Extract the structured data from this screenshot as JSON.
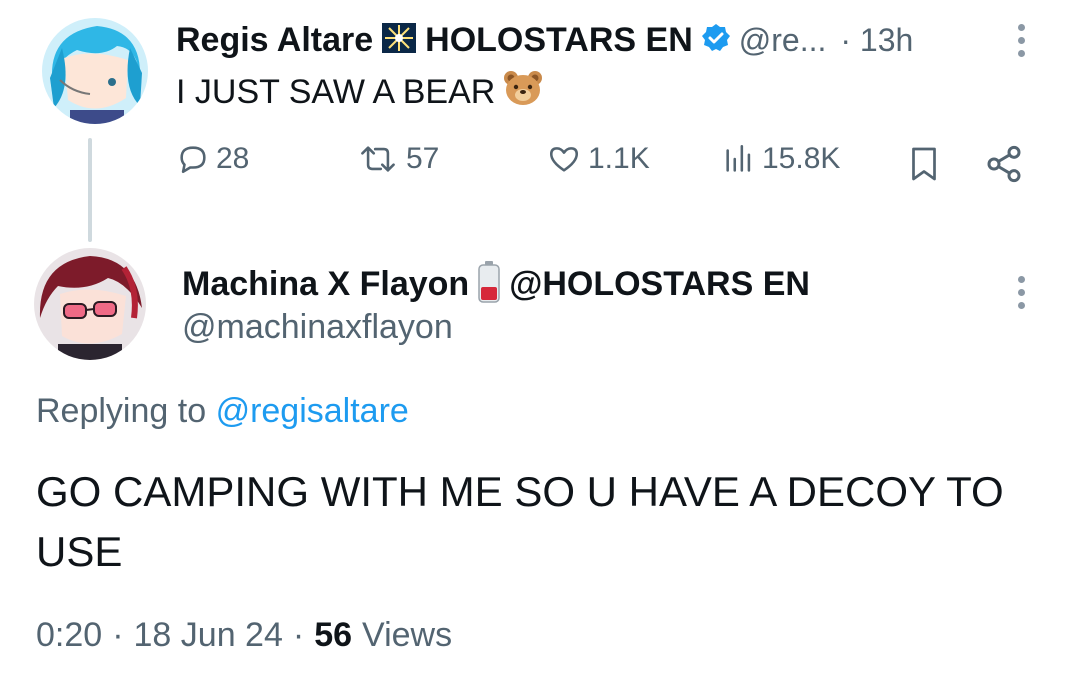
{
  "parent_tweet": {
    "display_name": "Regis Altare",
    "org_label": "HOLOSTARS EN",
    "handle": "@re...",
    "time": "· 13h",
    "text": "I JUST SAW A BEAR",
    "emoji": "🐻",
    "actions": {
      "replies": "28",
      "reposts": "57",
      "likes": "1.1K",
      "views": "15.8K"
    }
  },
  "reply_tweet": {
    "display_name": "Machina X Flayon",
    "org_label": "@HOLOSTARS EN",
    "handle": "@machinaxflayon",
    "replying_prefix": "Replying to",
    "replying_handle": "@regisaltare",
    "text": "GO CAMPING WITH ME SO U HAVE A DECOY TO USE",
    "meta_time": "0:20",
    "meta_sep1": "·",
    "meta_date": "18 Jun 24",
    "meta_sep2": "·",
    "views_count": "56",
    "views_label": "Views"
  },
  "colors": {
    "text": "#0f1419",
    "muted": "#536471",
    "link": "#1d9bf0",
    "verified": "#1d9bf0",
    "thread_line": "#cfd9de"
  },
  "icons": [
    "reply-icon",
    "repost-icon",
    "like-icon",
    "views-icon",
    "bookmark-icon",
    "share-icon",
    "more-icon",
    "verified-icon",
    "star-flag-icon",
    "battery-icon"
  ]
}
